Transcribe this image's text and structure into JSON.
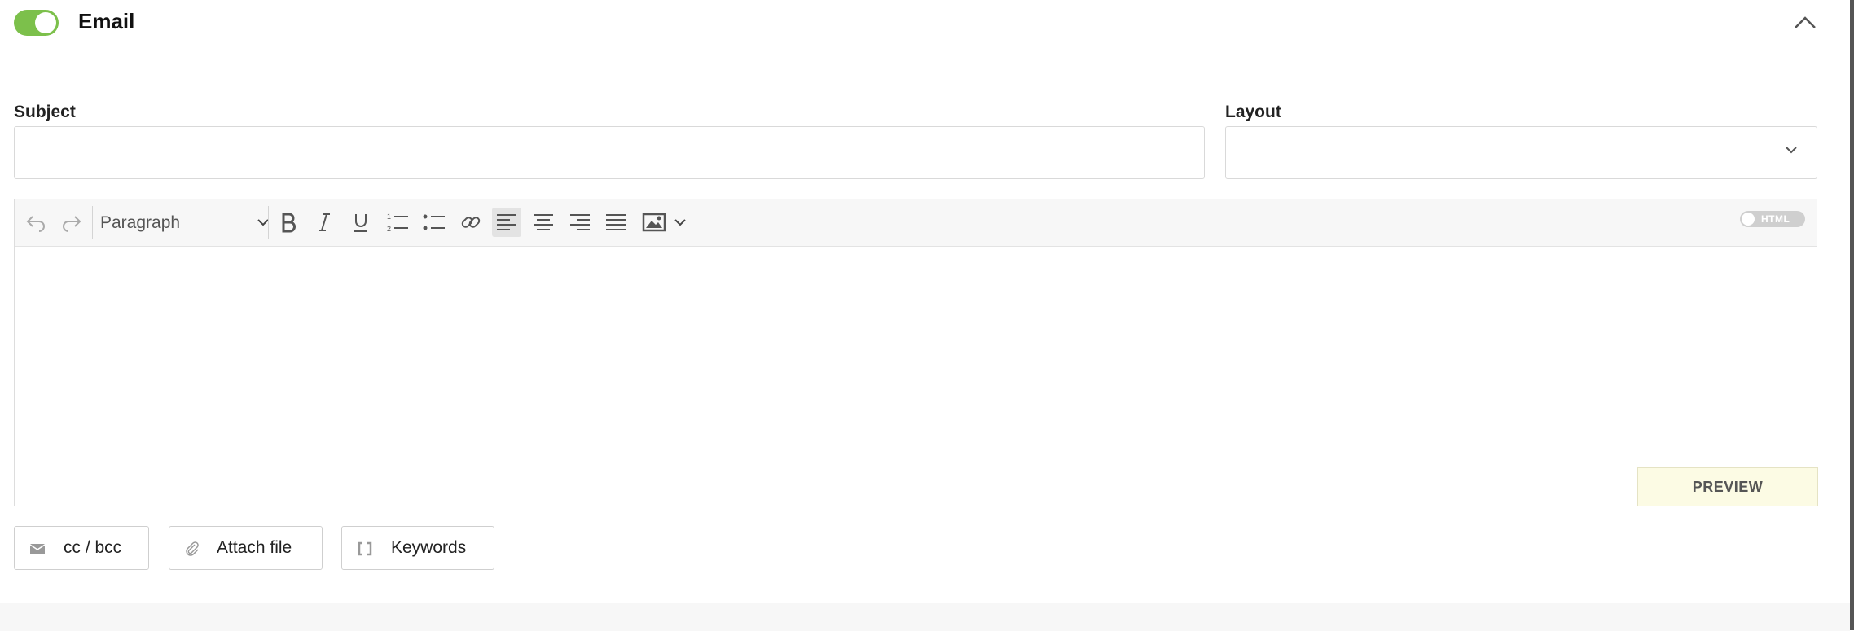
{
  "section": {
    "title": "Email",
    "enabled": true
  },
  "form": {
    "subject": {
      "label": "Subject",
      "value": "",
      "placeholder": ""
    },
    "layout": {
      "label": "Layout",
      "value": ""
    }
  },
  "editor": {
    "block_format": "Paragraph",
    "html_toggle_label": "HTML",
    "toolbar_icons": [
      "undo-icon",
      "redo-icon",
      "bold-icon",
      "italic-icon",
      "underline-icon",
      "numbered-list-icon",
      "bulleted-list-icon",
      "link-icon",
      "align-left-icon",
      "align-center-icon",
      "align-right-icon",
      "align-justify-icon",
      "image-icon",
      "chevron-down-icon"
    ],
    "active_alignment": "left",
    "content": "",
    "preview_label": "PREVIEW"
  },
  "actions": {
    "cc_bcc": "cc / bcc",
    "attach_file": "Attach file",
    "keywords": "Keywords"
  },
  "colors": {
    "toggle_on": "#7cc04b",
    "preview_bg": "#fcfbe4"
  }
}
